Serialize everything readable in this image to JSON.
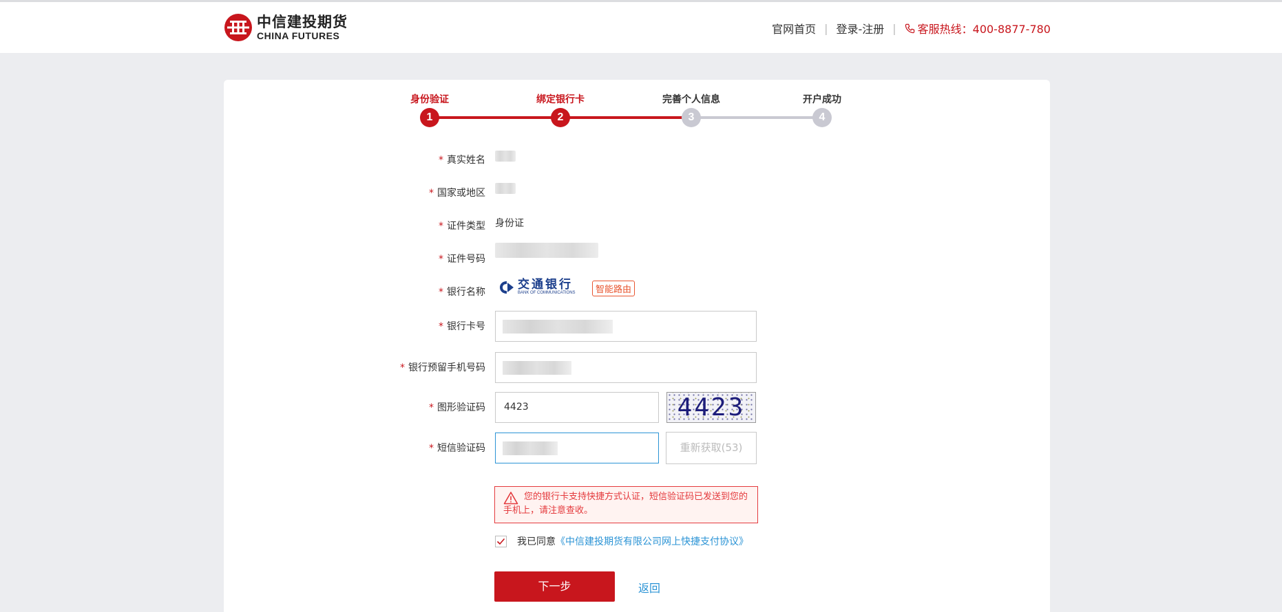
{
  "header": {
    "logo_cn": "中信建投期货",
    "logo_en": "CHINA FUTURES",
    "nav": {
      "home": "官网首页",
      "login": "登录-注册",
      "hotline": "客服热线：400-8877-780"
    }
  },
  "steps": [
    {
      "label": "身份验证",
      "number": "1",
      "status": "done"
    },
    {
      "label": "绑定银行卡",
      "number": "2",
      "status": "done"
    },
    {
      "label": "完善个人信息",
      "number": "3",
      "status": "pending"
    },
    {
      "label": "开户成功",
      "number": "4",
      "status": "pending"
    }
  ],
  "form": {
    "name_label": "真实姓名",
    "country_label": "国家或地区",
    "id_type_label": "证件类型",
    "id_type_value": "身份证",
    "id_number_label": "证件号码",
    "bank_name_label": "银行名称",
    "bank_name_cn": "交通银行",
    "bank_name_en": "BANK OF COMMUNICATIONS",
    "bank_tag": "智能路由",
    "card_label": "银行卡号",
    "phone_label": "银行预留手机号码",
    "captcha_label": "图形验证码",
    "captcha_value": "4423",
    "captcha_image_text": "4423",
    "sms_label": "短信验证码",
    "resend_label": "重新获取(53)",
    "required_mark": "*"
  },
  "alert": {
    "text": "您的银行卡支持快捷方式认证，短信验证码已发送到您的手机上，请注意查收。"
  },
  "agreement": {
    "prefix": "我已同意",
    "link": "《中信建投期货有限公司网上快捷支付协议》",
    "checked": true
  },
  "actions": {
    "next": "下一步",
    "back": "返回"
  },
  "colors": {
    "brand_red": "#c8161d",
    "link_blue": "#2a93d5",
    "alert_red": "#e4393c",
    "step_gray": "#c9c9d2"
  }
}
